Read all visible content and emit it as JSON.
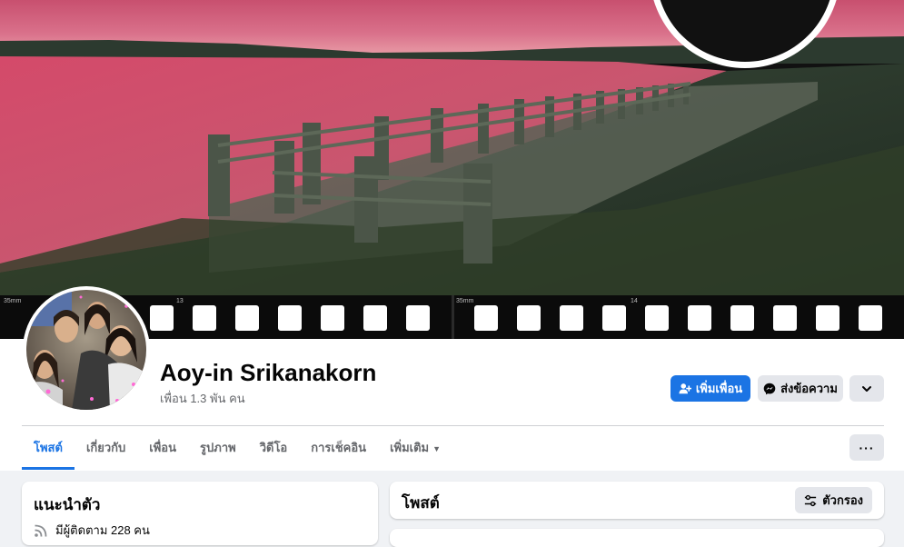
{
  "profile": {
    "name": "Aoy-in Srikanakorn",
    "friends": "เพื่อน 1.3 พัน คน"
  },
  "actions": {
    "add_friend": "เพิ่มเพื่อน",
    "message": "ส่งข้อความ"
  },
  "cover": {
    "film_label_left": "35mm",
    "film_label_mid": "13",
    "film_label_right": "35mm",
    "film_label_right_mid": "14"
  },
  "tabs": [
    {
      "label": "โพสต์",
      "active": true
    },
    {
      "label": "เกี่ยวกับ",
      "active": false
    },
    {
      "label": "เพื่อน",
      "active": false
    },
    {
      "label": "รูปภาพ",
      "active": false
    },
    {
      "label": "วิดีโอ",
      "active": false
    },
    {
      "label": "การเช็คอิน",
      "active": false
    },
    {
      "label": "เพิ่มเติม",
      "active": false
    }
  ],
  "intro": {
    "title": "แนะนำตัว",
    "followers": "มีผู้ติดตาม 228 คน"
  },
  "posts": {
    "title": "โพสต์",
    "filter": "ตัวกรอง"
  },
  "colors": {
    "accent": "#1b74e4",
    "background": "#f0f2f5",
    "secondary_button": "#e4e6eb"
  }
}
